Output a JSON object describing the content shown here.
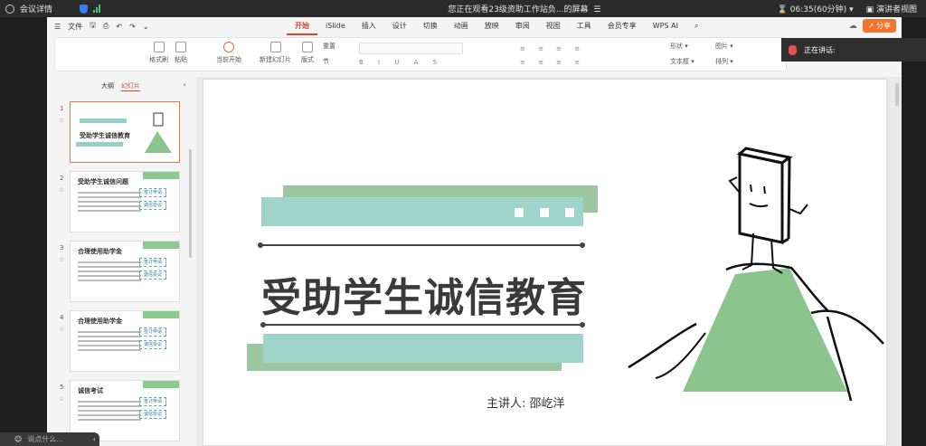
{
  "topbar": {
    "meeting_details": "会议详情",
    "screen_title": "您正在观看23级资助工作站负...的屏幕",
    "timer": "06:35(60分钟)",
    "view_mode": "演讲者视图"
  },
  "menu": {
    "file": "文件",
    "tabs": [
      "开始",
      "iSlide",
      "插入",
      "设计",
      "切换",
      "动画",
      "放映",
      "审阅",
      "视图",
      "工具",
      "会员专享",
      "WPS AI"
    ],
    "share": "分享"
  },
  "ribbon": {
    "format_painter": "格式刷",
    "paste": "粘贴",
    "play_from_current": "当前开始",
    "new_slide": "新建幻灯片",
    "layout": "版式",
    "reset": "重置",
    "section": "节",
    "shape": "形状",
    "picture": "图片",
    "textbox": "文本框",
    "arrange": "排列"
  },
  "speaking": {
    "label": "正在讲话:"
  },
  "sidepanel": {
    "tab_outline": "大纲",
    "tab_slides": "幻灯片",
    "thumbs": [
      {
        "num": "1",
        "title": "受助学生诚信教育"
      },
      {
        "num": "2",
        "title": "受助学生诚信问题",
        "chip1": "签订申请",
        "chip2": "诚信协议"
      },
      {
        "num": "3",
        "title": "合理使用助学金",
        "chip1": "签订申请",
        "chip2": "诚信协议"
      },
      {
        "num": "4",
        "title": "合理使用助学金",
        "chip1": "签订申请",
        "chip2": "诚信协议"
      },
      {
        "num": "5",
        "title": "诚信考试",
        "chip1": "签订申请",
        "chip2": "诚信协议"
      }
    ]
  },
  "slide": {
    "title": "受助学生诚信教育",
    "presenter": "主讲人:  邵屹洋"
  },
  "bottombar": {
    "placeholder": "说点什么..."
  },
  "colors": {
    "accent_teal": "#93d1c6",
    "accent_green": "#8cc48e",
    "tab_active": "#d7472f"
  }
}
